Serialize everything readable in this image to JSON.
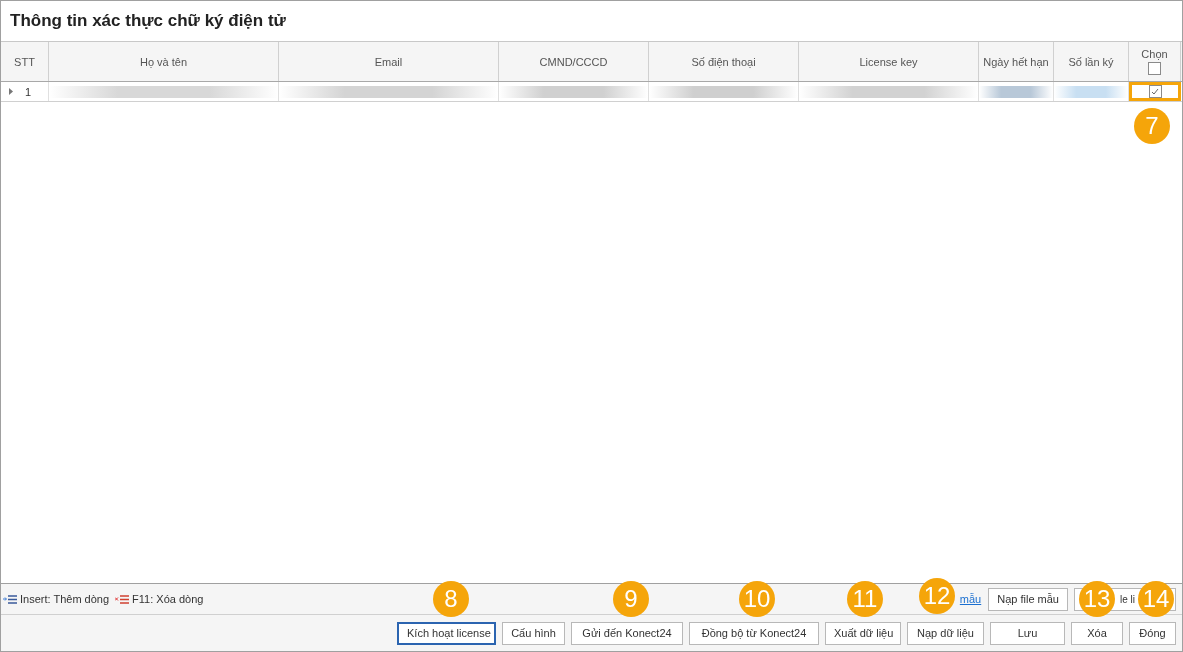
{
  "title": "Thông tin xác thực chữ ký điện tử",
  "columns": [
    {
      "label": "STT"
    },
    {
      "label": "Họ và tên"
    },
    {
      "label": "Email"
    },
    {
      "label": "CMND/CCCD"
    },
    {
      "label": "Số điện thoại"
    },
    {
      "label": "License key"
    },
    {
      "label": "Ngày hết hạn"
    },
    {
      "label": "Số lần ký"
    },
    {
      "label": "Chọn"
    }
  ],
  "select_all_checked": false,
  "rows": [
    {
      "index": "1",
      "current": true,
      "checked": true,
      "annotated": true
    }
  ],
  "hints": [
    {
      "kind": "insert",
      "text": "Insert: Thêm dòng"
    },
    {
      "kind": "delete",
      "text": "F11: Xóa dòng"
    }
  ],
  "template_link": "mẫu",
  "upper_buttons": [
    {
      "label": "Nạp file mẫu"
    },
    {
      "label": "le li"
    }
  ],
  "buttons": [
    {
      "label": "Kích hoạt license",
      "focused": true
    },
    {
      "label": "Cấu hình",
      "focused": false
    },
    {
      "label": "Gửi đến Konect24",
      "focused": false
    },
    {
      "label": "Đồng bộ từ Konect24",
      "focused": false
    },
    {
      "label": "Xuất dữ liệu",
      "focused": false
    },
    {
      "label": "Nạp dữ liệu",
      "focused": false
    },
    {
      "label": "Lưu",
      "focused": false
    },
    {
      "label": "Xóa",
      "focused": false
    },
    {
      "label": "Đóng",
      "focused": false
    }
  ],
  "callouts": [
    "7",
    "8",
    "9",
    "10",
    "11",
    "12",
    "13",
    "14"
  ]
}
